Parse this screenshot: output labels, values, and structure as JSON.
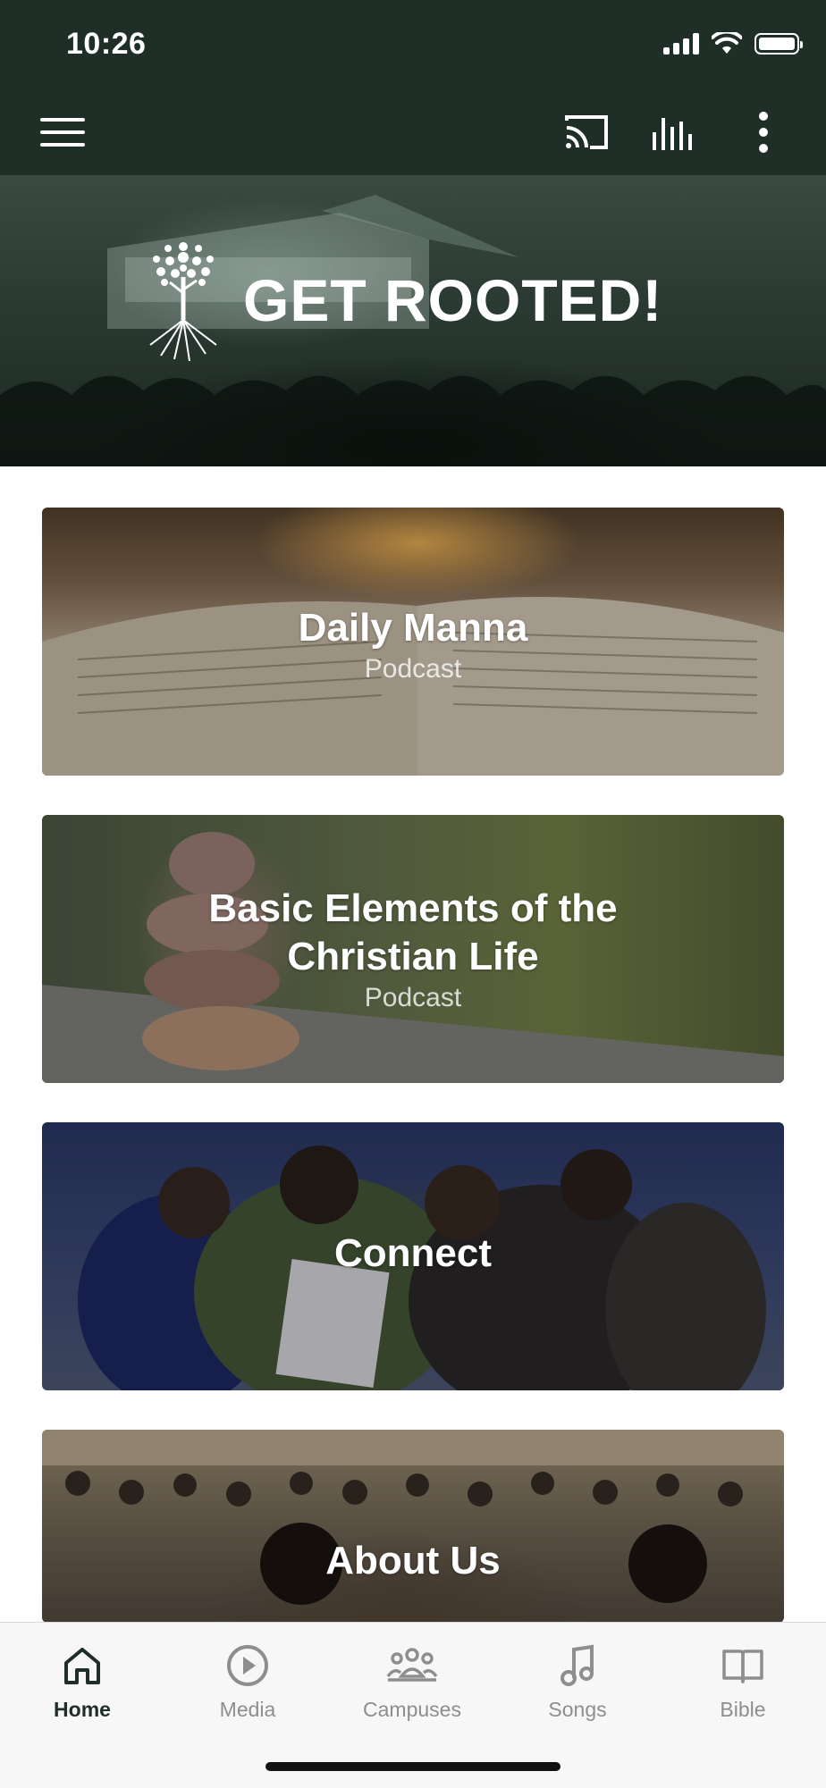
{
  "status_bar": {
    "time": "10:26"
  },
  "toolbar": {
    "icons": [
      "menu-icon",
      "cast-icon",
      "equalizer-icon",
      "more-vert-icon"
    ]
  },
  "hero": {
    "title": "GET ROOTED!"
  },
  "cards": [
    {
      "title": "Daily Manna",
      "subtitle": "Podcast"
    },
    {
      "title": "Basic Elements of the Christian Life",
      "subtitle": "Podcast"
    },
    {
      "title": "Connect",
      "subtitle": ""
    },
    {
      "title": "About Us",
      "subtitle": ""
    }
  ],
  "bottom_nav": {
    "active": "Home",
    "items": [
      {
        "label": "Home",
        "icon": "home-icon"
      },
      {
        "label": "Media",
        "icon": "play-circle-icon"
      },
      {
        "label": "Campuses",
        "icon": "group-icon"
      },
      {
        "label": "Songs",
        "icon": "music-note-icon"
      },
      {
        "label": "Bible",
        "icon": "book-icon"
      }
    ]
  },
  "colors": {
    "header": "#1f2f27",
    "nav_active": "#1f2f27",
    "nav_inactive": "#8e8e8e"
  }
}
